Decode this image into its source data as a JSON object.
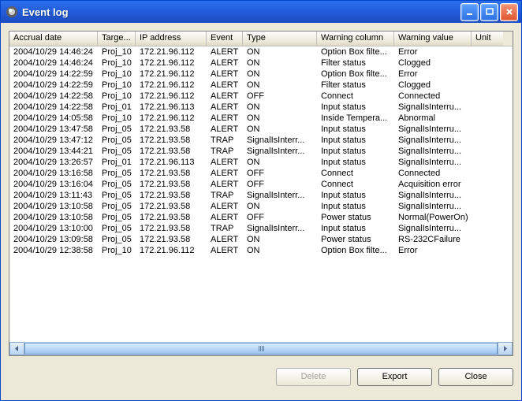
{
  "window": {
    "title": "Event log"
  },
  "columns": [
    {
      "label": "Accrual date",
      "width": 112
    },
    {
      "label": "Targe...",
      "width": 48
    },
    {
      "label": "IP address",
      "width": 90
    },
    {
      "label": "Event",
      "width": 46
    },
    {
      "label": "Type",
      "width": 94
    },
    {
      "label": "Warning column",
      "width": 98
    },
    {
      "label": "Warning value",
      "width": 98
    },
    {
      "label": "Unit",
      "width": 40
    }
  ],
  "rows": [
    [
      "2004/10/29 14:46:24",
      "Proj_10",
      "172.21.96.112",
      "ALERT",
      "ON",
      "Option Box filte...",
      "Error",
      ""
    ],
    [
      "2004/10/29 14:46:24",
      "Proj_10",
      "172.21.96.112",
      "ALERT",
      "ON",
      "Filter status",
      "Clogged",
      ""
    ],
    [
      "2004/10/29 14:22:59",
      "Proj_10",
      "172.21.96.112",
      "ALERT",
      "ON",
      "Option Box filte...",
      "Error",
      ""
    ],
    [
      "2004/10/29 14:22:59",
      "Proj_10",
      "172.21.96.112",
      "ALERT",
      "ON",
      "Filter status",
      "Clogged",
      ""
    ],
    [
      "2004/10/29 14:22:58",
      "Proj_10",
      "172.21.96.112",
      "ALERT",
      "OFF",
      "Connect",
      "Connected",
      ""
    ],
    [
      "2004/10/29 14:22:58",
      "Proj_01",
      "172.21.96.113",
      "ALERT",
      "ON",
      "Input status",
      "SignalIsInterru...",
      ""
    ],
    [
      "2004/10/29 14:05:58",
      "Proj_10",
      "172.21.96.112",
      "ALERT",
      "ON",
      "Inside Tempera...",
      "Abnormal",
      ""
    ],
    [
      "2004/10/29 13:47:58",
      "Proj_05",
      "172.21.93.58",
      "ALERT",
      "ON",
      "Input status",
      "SignalIsInterru...",
      ""
    ],
    [
      "2004/10/29 13:47:12",
      "Proj_05",
      "172.21.93.58",
      "TRAP",
      "SignalIsInterr...",
      "Input status",
      "SignalIsInterru...",
      ""
    ],
    [
      "2004/10/29 13:44:21",
      "Proj_05",
      "172.21.93.58",
      "TRAP",
      "SignalIsInterr...",
      "Input status",
      "SignalIsInterru...",
      ""
    ],
    [
      "2004/10/29 13:26:57",
      "Proj_01",
      "172.21.96.113",
      "ALERT",
      "ON",
      "Input status",
      "SignalIsInterru...",
      ""
    ],
    [
      "2004/10/29 13:16:58",
      "Proj_05",
      "172.21.93.58",
      "ALERT",
      "OFF",
      "Connect",
      "Connected",
      ""
    ],
    [
      "2004/10/29 13:16:04",
      "Proj_05",
      "172.21.93.58",
      "ALERT",
      "OFF",
      "Connect",
      "Acquisition error",
      ""
    ],
    [
      "2004/10/29 13:11:43",
      "Proj_05",
      "172.21.93.58",
      "TRAP",
      "SignalIsInterr...",
      "Input status",
      "SignalIsInterru...",
      ""
    ],
    [
      "2004/10/29 13:10:58",
      "Proj_05",
      "172.21.93.58",
      "ALERT",
      "ON",
      "Input status",
      "SignalIsInterru...",
      ""
    ],
    [
      "2004/10/29 13:10:58",
      "Proj_05",
      "172.21.93.58",
      "ALERT",
      "OFF",
      "Power status",
      "Normal(PowerOn)",
      ""
    ],
    [
      "2004/10/29 13:10:00",
      "Proj_05",
      "172.21.93.58",
      "TRAP",
      "SignalIsInterr...",
      "Input status",
      "SignalIsInterru...",
      ""
    ],
    [
      "2004/10/29 13:09:58",
      "Proj_05",
      "172.21.93.58",
      "ALERT",
      "ON",
      "Power status",
      "RS-232CFailure",
      ""
    ],
    [
      "2004/10/29 12:38:58",
      "Proj_10",
      "172.21.96.112",
      "ALERT",
      "ON",
      "Option Box filte...",
      "Error",
      ""
    ]
  ],
  "buttons": {
    "delete": "Delete",
    "export": "Export",
    "close": "Close"
  }
}
